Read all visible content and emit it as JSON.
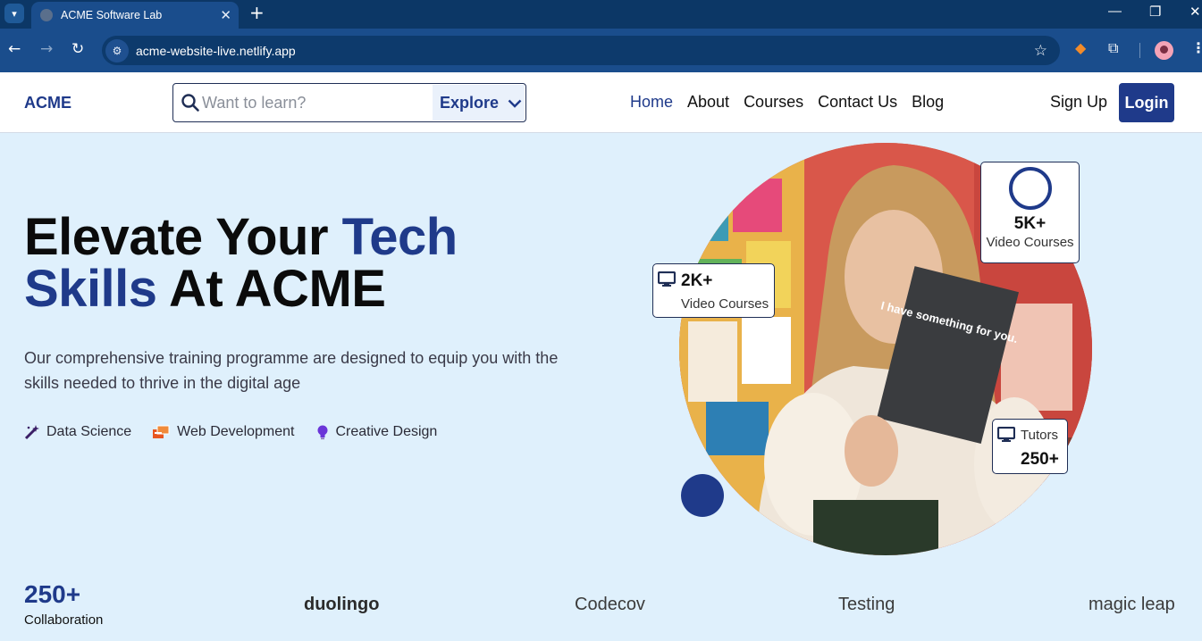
{
  "browser": {
    "tab_title": "ACME Software Lab",
    "url": "acme-website-live.netlify.app",
    "window_controls": [
      "minimize-icon",
      "restore-icon",
      "close-icon"
    ]
  },
  "header": {
    "logo": "ACME",
    "search": {
      "placeholder": "Want to learn?",
      "value": ""
    },
    "explore_label": "Explore",
    "nav": [
      {
        "label": "Home",
        "active": true
      },
      {
        "label": "About",
        "active": false
      },
      {
        "label": "Courses",
        "active": false
      },
      {
        "label": "Contact Us",
        "active": false
      },
      {
        "label": "Blog",
        "active": false
      }
    ],
    "signup_label": "Sign Up",
    "login_label": "Login"
  },
  "hero": {
    "title_part1": "Elevate Your ",
    "title_accent1": "Tech",
    "title_accent2": "Skills",
    "title_part2": " At ACME",
    "description": "Our comprehensive training programme are designed to equip you with the skills needed to thrive in the digital age",
    "tags": [
      {
        "label": "Data Science",
        "icon": "magic-wand-icon"
      },
      {
        "label": "Web Development",
        "icon": "web-dev-icon"
      },
      {
        "label": "Creative Design",
        "icon": "lightbulb-icon"
      }
    ],
    "photo_text": "I have something for you."
  },
  "stats": {
    "video_courses_5k": {
      "value": "5K+",
      "label": "Video Courses"
    },
    "video_courses_2k": {
      "value": "2K+",
      "label": "Video Courses"
    },
    "tutors": {
      "value": "250+",
      "label": "Tutors"
    }
  },
  "partners": {
    "collab_count": "250+",
    "collab_label": "Collaboration",
    "logos": [
      "duolingo",
      "Codecov",
      "Testing",
      "magic leap"
    ]
  },
  "colors": {
    "brand": "#1f3a8a",
    "hero_bg": "#dff0fc",
    "browser_tabbar": "#0c3766",
    "browser_toolbar": "#1a4d8c"
  }
}
